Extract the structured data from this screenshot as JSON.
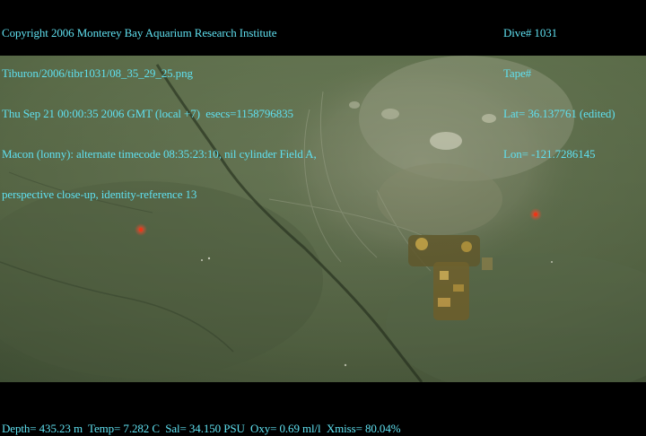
{
  "overlay": {
    "left_lines": [
      "Copyright 2006 Monterey Bay Aquarium Research Institute",
      "Tiburon/2006/tibr1031/08_35_29_25.png",
      "Thu Sep 21 00:00:35 2006 GMT (local +7)  esecs=1158796835",
      "Macon (lonny): alternate timecode 08:35:23:10, nil cylinder Field A,",
      "perspective close-up, identity-reference 13"
    ],
    "right_lines": [
      "Dive# 1031",
      "Tape#",
      "Lat= 36.137761 (edited)",
      "Lon= -121.7286145"
    ],
    "bottom_line": "Depth= 435.23 m  Temp= 7.282 C  Sal= 34.150 PSU  Oxy= 0.69 ml/l  Xmiss= 80.04%"
  },
  "colors": {
    "overlay_text": "#5fe0f0",
    "background": "#000000",
    "water": "#5a6b4a",
    "laser_dot": "#ff4020"
  }
}
